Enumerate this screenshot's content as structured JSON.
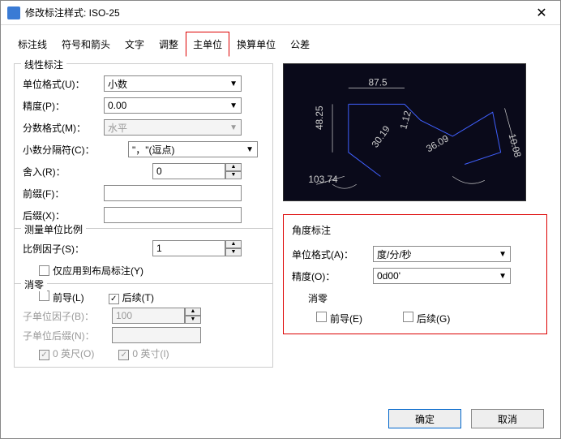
{
  "window": {
    "title": "修改标注样式: ISO-25"
  },
  "tabs": [
    "标注线",
    "符号和箭头",
    "文字",
    "调整",
    "主单位",
    "换算单位",
    "公差"
  ],
  "active_tab": 4,
  "linear": {
    "title": "线性标注",
    "unit_format": {
      "label": "单位格式(U)：",
      "value": "小数"
    },
    "precision": {
      "label": "精度(P)：",
      "value": "0.00"
    },
    "fraction": {
      "label": "分数格式(M)：",
      "value": "水平"
    },
    "decimal_sep": {
      "label": "小数分隔符(C)：",
      "value": "\"，\"(逗点)"
    },
    "roundoff": {
      "label": "舍入(R)：",
      "value": "0"
    },
    "prefix": {
      "label": "前缀(F)：",
      "value": ""
    },
    "suffix": {
      "label": "后缀(X)：",
      "value": ""
    }
  },
  "scale": {
    "title": "测量单位比例",
    "factor": {
      "label": "比例因子(S)：",
      "value": "1"
    },
    "layout_only": {
      "label": "仅应用到布局标注(Y)"
    }
  },
  "zero": {
    "title": "消零",
    "leading": "前导(L)",
    "trailing": "后续(T)",
    "sub_factor": {
      "label": "子单位因子(B)：",
      "value": "100"
    },
    "sub_suffix": {
      "label": "子单位后缀(N)：",
      "value": ""
    },
    "feet": "0 英尺(O)",
    "inch": "0 英寸(I)"
  },
  "angle": {
    "title": "角度标注",
    "unit_format": {
      "label": "单位格式(A)：",
      "value": "度/分/秒"
    },
    "precision": {
      "label": "精度(O)：",
      "value": "0d00'"
    },
    "zero": {
      "title": "消零",
      "leading": "前导(E)",
      "trailing": "后续(G)"
    }
  },
  "preview": {
    "dims": {
      "top": "87.5",
      "left": "48.25",
      "diag1": "30.19",
      "diag2": "1.12",
      "diag3": "36.09",
      "right": "10.08",
      "radius": "103.74"
    }
  },
  "buttons": {
    "ok": "确定",
    "cancel": "取消"
  }
}
